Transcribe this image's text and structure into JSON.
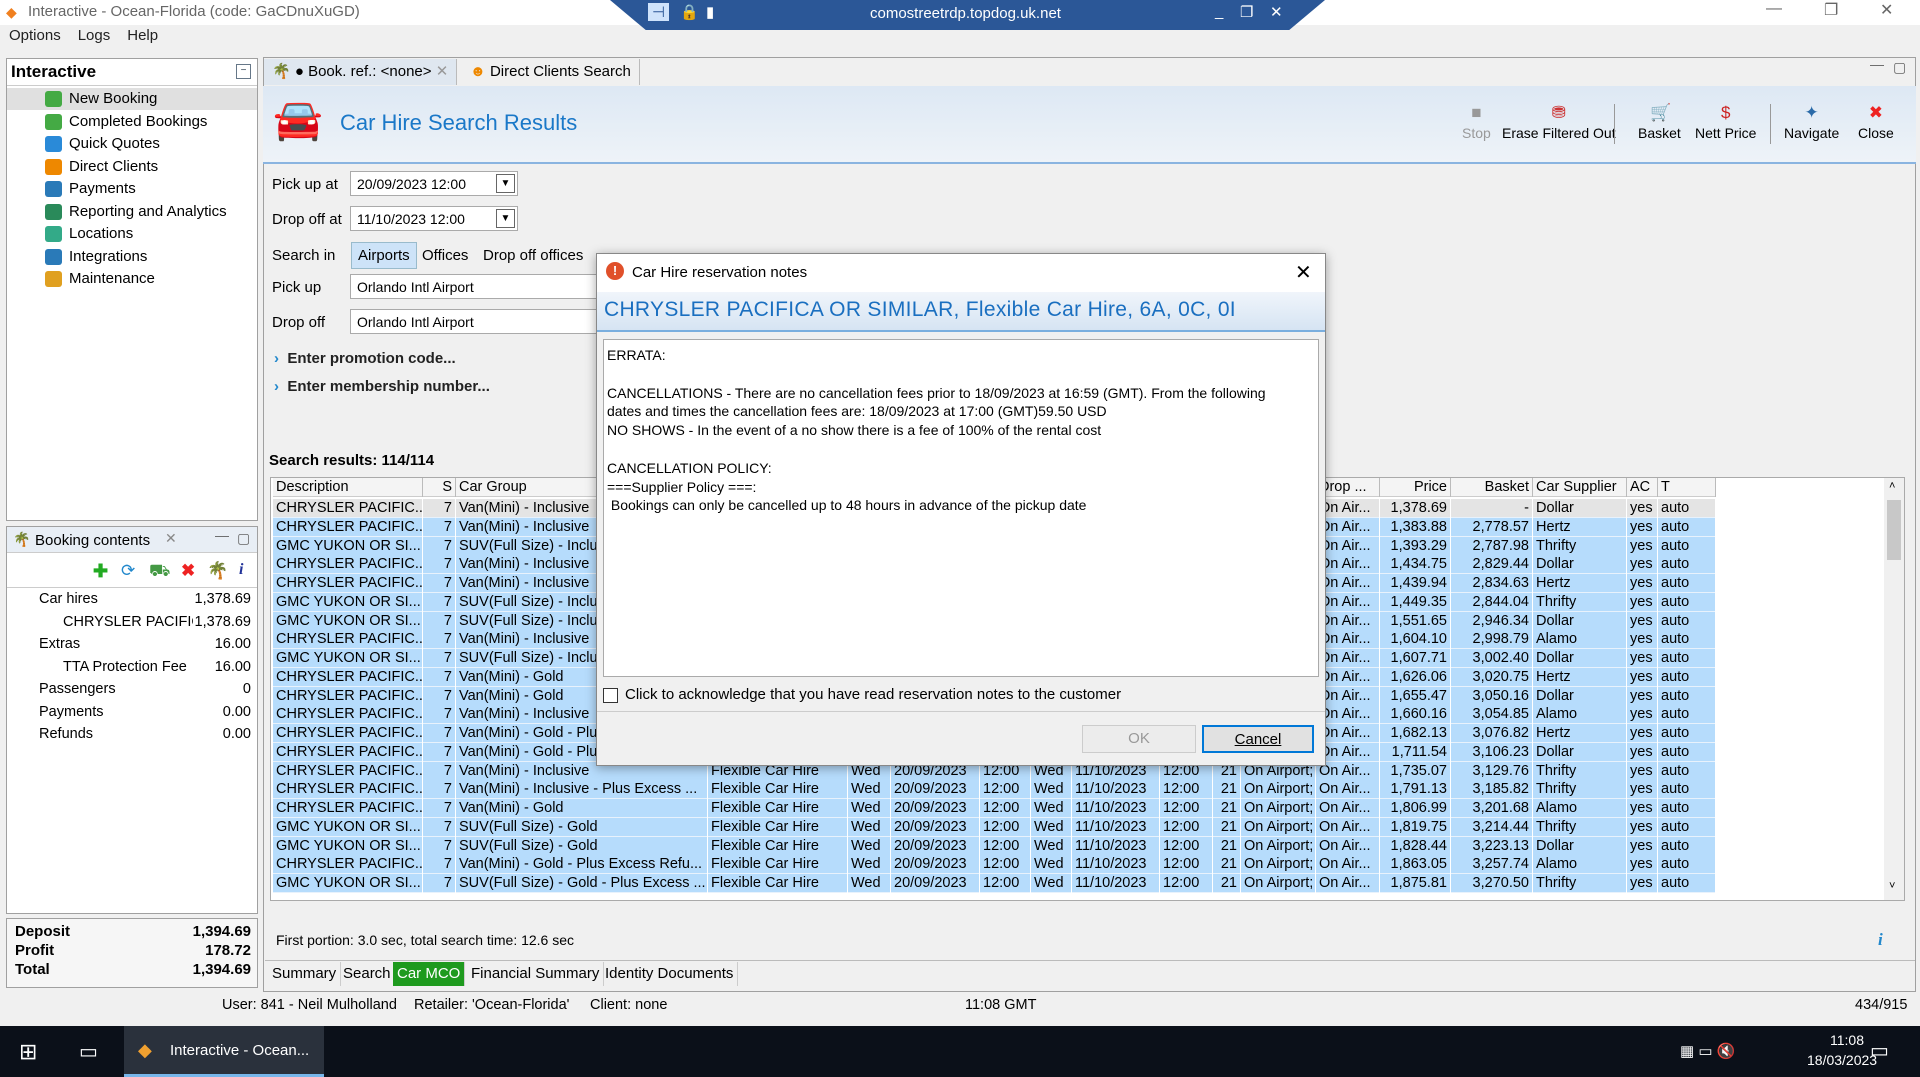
{
  "window": {
    "title": "Interactive - Ocean-Florida (code: GaCDnuXuGD)",
    "rdp_host": "comostreetrdp.topdog.uk.net"
  },
  "menu": [
    "Options",
    "Logs",
    "Help"
  ],
  "sidebar": {
    "title": "Interactive",
    "items": [
      {
        "label": "New Booking"
      },
      {
        "label": "Completed Bookings"
      },
      {
        "label": "Quick Quotes"
      },
      {
        "label": "Direct Clients"
      },
      {
        "label": "Payments"
      },
      {
        "label": "Reporting and Analytics"
      },
      {
        "label": "Locations"
      },
      {
        "label": "Integrations"
      },
      {
        "label": "Maintenance"
      }
    ]
  },
  "booking_contents": {
    "title": "Booking contents",
    "lines": [
      {
        "label": "Car hires",
        "value": "1,378.69",
        "indent": 0
      },
      {
        "label": "CHRYSLER PACIFIC/",
        "value": "1,378.69",
        "indent": 1
      },
      {
        "label": "Extras",
        "value": "16.00",
        "indent": 0
      },
      {
        "label": "TTA Protection Fee",
        "value": "16.00",
        "indent": 1
      },
      {
        "label": "Passengers",
        "value": "0",
        "indent": 0
      },
      {
        "label": "Payments",
        "value": "0.00",
        "indent": 0
      },
      {
        "label": "Refunds",
        "value": "0.00",
        "indent": 0
      }
    ],
    "totals": [
      {
        "label": "Deposit",
        "value": "1,394.69"
      },
      {
        "label": "Profit",
        "value": "178.72"
      },
      {
        "label": "Total",
        "value": "1,394.69"
      }
    ]
  },
  "tabs": [
    {
      "label": "● Book. ref.: <none>"
    },
    {
      "label": "Direct Clients Search"
    }
  ],
  "header": {
    "title": "Car Hire Search Results"
  },
  "toolbar": [
    {
      "label": "Stop",
      "icon": "■"
    },
    {
      "label": "Erase Filtered Out",
      "icon": "⛃"
    },
    {
      "label": "Basket",
      "icon": "🛒"
    },
    {
      "label": "Nett Price",
      "icon": "$"
    },
    {
      "label": "Navigate",
      "icon": "✦"
    },
    {
      "label": "Close",
      "icon": "✖"
    }
  ],
  "form": {
    "pickup_at_label": "Pick up at",
    "pickup_at": "20/09/2023 12:00",
    "dropoff_at_label": "Drop off at",
    "dropoff_at": "11/10/2023 12:00",
    "search_in_label": "Search in",
    "search_in_options": [
      "Airports",
      "Offices",
      "Drop off offices"
    ],
    "pickup_label": "Pick up",
    "pickup": "Orlando Intl Airport",
    "dropoff_label": "Drop off",
    "dropoff": "Orlando Intl Airport",
    "promo": "Enter promotion code...",
    "membership": "Enter membership number..."
  },
  "results": {
    "count_label": "Search results: 114/114",
    "timing": "First portion: 3.0 sec, total search time: 12.6 sec",
    "columns": [
      "Description",
      "S",
      "Car Group",
      "",
      "",
      "",
      "",
      "",
      "",
      "",
      "",
      "",
      "Drop ...",
      "Price",
      "Basket",
      "Car Supplier",
      "AC",
      "T"
    ],
    "rows": [
      [
        "CHRYSLER PACIFIC...",
        "7",
        "Van(Mini) - Inclusive",
        "",
        "",
        "",
        "",
        "",
        "",
        "",
        "",
        "",
        "On Air...",
        "1,378.69",
        "-",
        "Dollar",
        "yes",
        "auto"
      ],
      [
        "CHRYSLER PACIFIC...",
        "7",
        "Van(Mini) - Inclusive",
        "",
        "",
        "",
        "",
        "",
        "",
        "",
        "",
        "",
        "On Air...",
        "1,383.88",
        "2,778.57",
        "Hertz",
        "yes",
        "auto"
      ],
      [
        "GMC YUKON OR SI...",
        "7",
        "SUV(Full Size) - Inclus",
        "",
        "",
        "",
        "",
        "",
        "",
        "",
        "",
        "",
        "On Air...",
        "1,393.29",
        "2,787.98",
        "Thrifty",
        "yes",
        "auto"
      ],
      [
        "CHRYSLER PACIFIC...",
        "7",
        "Van(Mini) - Inclusive",
        "",
        "",
        "",
        "",
        "",
        "",
        "",
        "",
        "",
        "On Air...",
        "1,434.75",
        "2,829.44",
        "Dollar",
        "yes",
        "auto"
      ],
      [
        "CHRYSLER PACIFIC...",
        "7",
        "Van(Mini) - Inclusive",
        "",
        "",
        "",
        "",
        "",
        "",
        "",
        "",
        "",
        "On Air...",
        "1,439.94",
        "2,834.63",
        "Hertz",
        "yes",
        "auto"
      ],
      [
        "GMC YUKON OR SI...",
        "7",
        "SUV(Full Size) - Inclus",
        "",
        "",
        "",
        "",
        "",
        "",
        "",
        "",
        "",
        "On Air...",
        "1,449.35",
        "2,844.04",
        "Thrifty",
        "yes",
        "auto"
      ],
      [
        "GMC YUKON OR SI...",
        "7",
        "SUV(Full Size) - Inclus",
        "",
        "",
        "",
        "",
        "",
        "",
        "",
        "",
        "",
        "On Air...",
        "1,551.65",
        "2,946.34",
        "Dollar",
        "yes",
        "auto"
      ],
      [
        "CHRYSLER PACIFIC...",
        "7",
        "Van(Mini) - Inclusive",
        "",
        "",
        "",
        "",
        "",
        "",
        "",
        "",
        "",
        "On Air...",
        "1,604.10",
        "2,998.79",
        "Alamo",
        "yes",
        "auto"
      ],
      [
        "GMC YUKON OR SI...",
        "7",
        "SUV(Full Size) - Inclus",
        "",
        "",
        "",
        "",
        "",
        "",
        "",
        "",
        "",
        "On Air...",
        "1,607.71",
        "3,002.40",
        "Dollar",
        "yes",
        "auto"
      ],
      [
        "CHRYSLER PACIFIC...",
        "7",
        "Van(Mini) - Gold",
        "",
        "",
        "",
        "",
        "",
        "",
        "",
        "",
        "",
        "On Air...",
        "1,626.06",
        "3,020.75",
        "Hertz",
        "yes",
        "auto"
      ],
      [
        "CHRYSLER PACIFIC...",
        "7",
        "Van(Mini) - Gold",
        "",
        "",
        "",
        "",
        "",
        "",
        "",
        "",
        "",
        "On Air...",
        "1,655.47",
        "3,050.16",
        "Dollar",
        "yes",
        "auto"
      ],
      [
        "CHRYSLER PACIFIC...",
        "7",
        "Van(Mini) - Inclusive",
        "",
        "",
        "",
        "",
        "",
        "",
        "",
        "",
        "",
        "On Air...",
        "1,660.16",
        "3,054.85",
        "Alamo",
        "yes",
        "auto"
      ],
      [
        "CHRYSLER PACIFIC...",
        "7",
        "Van(Mini) - Gold - Plu",
        "",
        "",
        "",
        "",
        "",
        "",
        "",
        "",
        "",
        "On Air...",
        "1,682.13",
        "3,076.82",
        "Hertz",
        "yes",
        "auto"
      ],
      [
        "CHRYSLER PACIFIC...",
        "7",
        "Van(Mini) - Gold - Plu",
        "",
        "",
        "",
        "",
        "",
        "",
        "",
        "",
        "",
        "On Air...",
        "1,711.54",
        "3,106.23",
        "Dollar",
        "yes",
        "auto"
      ],
      [
        "CHRYSLER PACIFIC...",
        "7",
        "Van(Mini) - Inclusive",
        "Flexible Car Hire",
        "Wed",
        "20/09/2023",
        "12:00",
        "Wed",
        "11/10/2023",
        "12:00",
        "21",
        "On Airport; ...",
        "On Air...",
        "1,735.07",
        "3,129.76",
        "Thrifty",
        "yes",
        "auto"
      ],
      [
        "CHRYSLER PACIFIC...",
        "7",
        "Van(Mini) - Inclusive - Plus Excess ...",
        "Flexible Car Hire",
        "Wed",
        "20/09/2023",
        "12:00",
        "Wed",
        "11/10/2023",
        "12:00",
        "21",
        "On Airport; ...",
        "On Air...",
        "1,791.13",
        "3,185.82",
        "Thrifty",
        "yes",
        "auto"
      ],
      [
        "CHRYSLER PACIFIC...",
        "7",
        "Van(Mini) - Gold",
        "Flexible Car Hire",
        "Wed",
        "20/09/2023",
        "12:00",
        "Wed",
        "11/10/2023",
        "12:00",
        "21",
        "On Airport; ...",
        "On Air...",
        "1,806.99",
        "3,201.68",
        "Alamo",
        "yes",
        "auto"
      ],
      [
        "GMC YUKON OR SI...",
        "7",
        "SUV(Full Size) - Gold",
        "Flexible Car Hire",
        "Wed",
        "20/09/2023",
        "12:00",
        "Wed",
        "11/10/2023",
        "12:00",
        "21",
        "On Airport; ...",
        "On Air...",
        "1,819.75",
        "3,214.44",
        "Thrifty",
        "yes",
        "auto"
      ],
      [
        "GMC YUKON OR SI...",
        "7",
        "SUV(Full Size) - Gold",
        "Flexible Car Hire",
        "Wed",
        "20/09/2023",
        "12:00",
        "Wed",
        "11/10/2023",
        "12:00",
        "21",
        "On Airport; ...",
        "On Air...",
        "1,828.44",
        "3,223.13",
        "Dollar",
        "yes",
        "auto"
      ],
      [
        "CHRYSLER PACIFIC...",
        "7",
        "Van(Mini) - Gold - Plus Excess Refu...",
        "Flexible Car Hire",
        "Wed",
        "20/09/2023",
        "12:00",
        "Wed",
        "11/10/2023",
        "12:00",
        "21",
        "On Airport; ...",
        "On Air...",
        "1,863.05",
        "3,257.74",
        "Alamo",
        "yes",
        "auto"
      ],
      [
        "GMC YUKON OR SI...",
        "7",
        "SUV(Full Size) - Gold - Plus Excess ...",
        "Flexible Car Hire",
        "Wed",
        "20/09/2023",
        "12:00",
        "Wed",
        "11/10/2023",
        "12:00",
        "21",
        "On Airport; ...",
        "On Air...",
        "1,875.81",
        "3,270.50",
        "Thrifty",
        "yes",
        "auto"
      ]
    ]
  },
  "bottom_tabs": [
    {
      "label": "Summary"
    },
    {
      "label": "Search"
    },
    {
      "label": "Car MCO",
      "active": true
    },
    {
      "label": "Financial Summary"
    },
    {
      "label": "Identity Documents"
    }
  ],
  "dialog": {
    "title": "Car Hire reservation notes",
    "heading": "CHRYSLER PACIFICA OR SIMILAR, Flexible Car Hire, 6A, 0C, 0I",
    "notes": "ERRATA:\n\nCANCELLATIONS - There are no cancellation fees prior to 18/09/2023 at 16:59 (GMT). From the following\ndates and times the cancellation fees are: 18/09/2023 at 17:00 (GMT)59.50 USD\nNO SHOWS - In the event of a no show there is a fee of 100% of the rental cost\n\nCANCELLATION POLICY:\n===Supplier Policy ===:\n Bookings can only be cancelled up to 48 hours in advance of the pickup date",
    "ack_label": "Click to acknowledge that you have read reservation notes to the customer",
    "ok": "OK",
    "cancel": "Cancel"
  },
  "statusbar": {
    "user": "User: 841 - Neil Mulholland",
    "retailer": "Retailer: 'Ocean-Florida'",
    "client": "Client: none",
    "time": "11:08 GMT",
    "counter": "434/915"
  },
  "taskbar": {
    "app": "Interactive - Ocean...",
    "time": "11:08",
    "date": "18/03/2023"
  }
}
